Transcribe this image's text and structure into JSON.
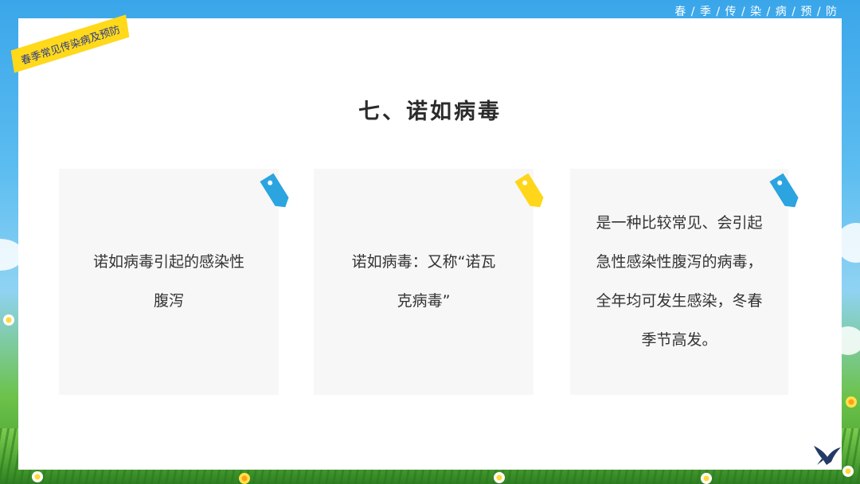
{
  "header": {
    "series_title": "春 / 季 / 传 / 染 / 病 / 预 / 防"
  },
  "tape_label": "春季常见传染病及预防",
  "heading": "七、诺如病毒",
  "cards": [
    {
      "text": "诺如病毒引起的感染性腹泻",
      "tag_color": "#2ba4e0"
    },
    {
      "text": "诺如病毒：又称“诺瓦克病毒”",
      "tag_color": "#ffd61a"
    },
    {
      "text": "是一种比较常见、会引起急性感染性腹泻的病毒，全年均可发生感染，冬春季节高发。",
      "tag_color": "#2ba4e0"
    }
  ],
  "icons": {
    "tag": "tag-icon",
    "swallow": "swallow-icon"
  }
}
